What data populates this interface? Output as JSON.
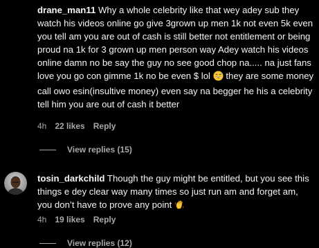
{
  "comments": [
    {
      "username": "drane_man11",
      "text": "Why a whole celebrity like that wey adey sub they watch his videos online go give 3grown up men 1k not even 5k even you tell am you are out of cash is still better not entitlement or being proud na 1k for 3 grown up men person way Adey watch his videos online damn no be say the guy no see good chop na..... na just fans love you go con gimme 1k no be even $ lol",
      "text_after_emoji": "they are some money call owo esin(insultive money) even say na begger he his a celebrity tell him you are out of cash it better",
      "emoji_icon": "grinning-sweat-emoji",
      "time": "4h",
      "likes": "22 likes",
      "reply_label": "Reply",
      "view_replies": "View replies (15)"
    },
    {
      "username": "tosin_darkchild",
      "text": "Though the guy might be entitled, but you see this things e dey clear way many times so just run am and forget am, you don’t have to prove any point",
      "emoji_icon": "waving-hand-emoji",
      "time": "4h",
      "likes": "19 likes",
      "reply_label": "Reply",
      "view_replies": "View replies (12)"
    }
  ],
  "colors": {
    "background": "#000000",
    "text": "#f5f5f5",
    "secondary": "#a8a8a8"
  }
}
